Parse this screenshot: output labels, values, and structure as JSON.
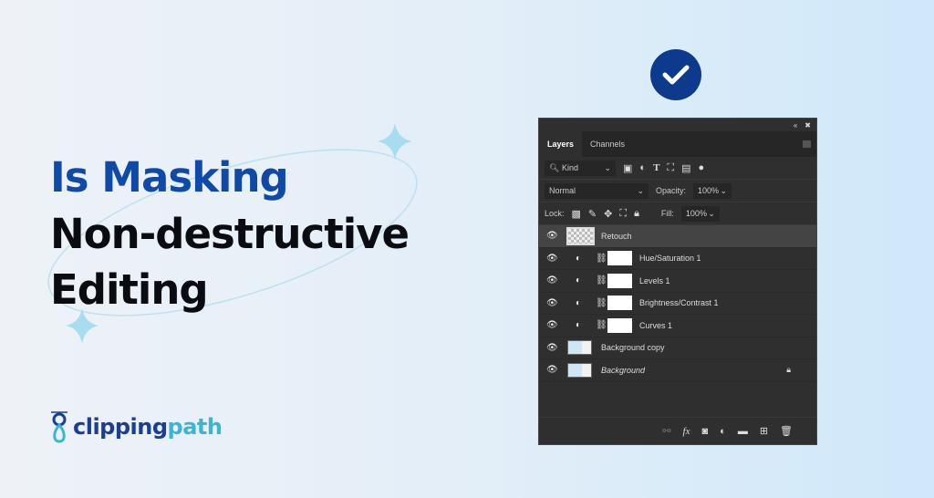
{
  "headline": {
    "line1": "Is Masking",
    "line2": "Non-destructive",
    "line3": "Editing"
  },
  "logo": {
    "part1": "clipping",
    "part2": "path"
  },
  "colors": {
    "title_blue": "#0f4aa8",
    "logo_dark": "#1b3f94",
    "logo_light": "#3ab5d6",
    "check_bg": "#0d3a8c"
  },
  "panel": {
    "tabs": [
      "Layers",
      "Channels"
    ],
    "filter": {
      "value": "Kind"
    },
    "blend": {
      "value": "Normal",
      "opacity_label": "Opacity:",
      "opacity": "100%"
    },
    "lock": {
      "label": "Lock:",
      "fill_label": "Fill:",
      "fill": "100%"
    },
    "layers": [
      {
        "name": "Retouch",
        "type": "pixel"
      },
      {
        "name": "Hue/Saturation 1",
        "type": "adjustment"
      },
      {
        "name": "Levels 1",
        "type": "adjustment"
      },
      {
        "name": "Brightness/Contrast 1",
        "type": "adjustment"
      },
      {
        "name": "Curves 1",
        "type": "adjustment"
      },
      {
        "name": "Background copy",
        "type": "image"
      },
      {
        "name": "Background",
        "type": "image",
        "locked": true
      }
    ]
  }
}
